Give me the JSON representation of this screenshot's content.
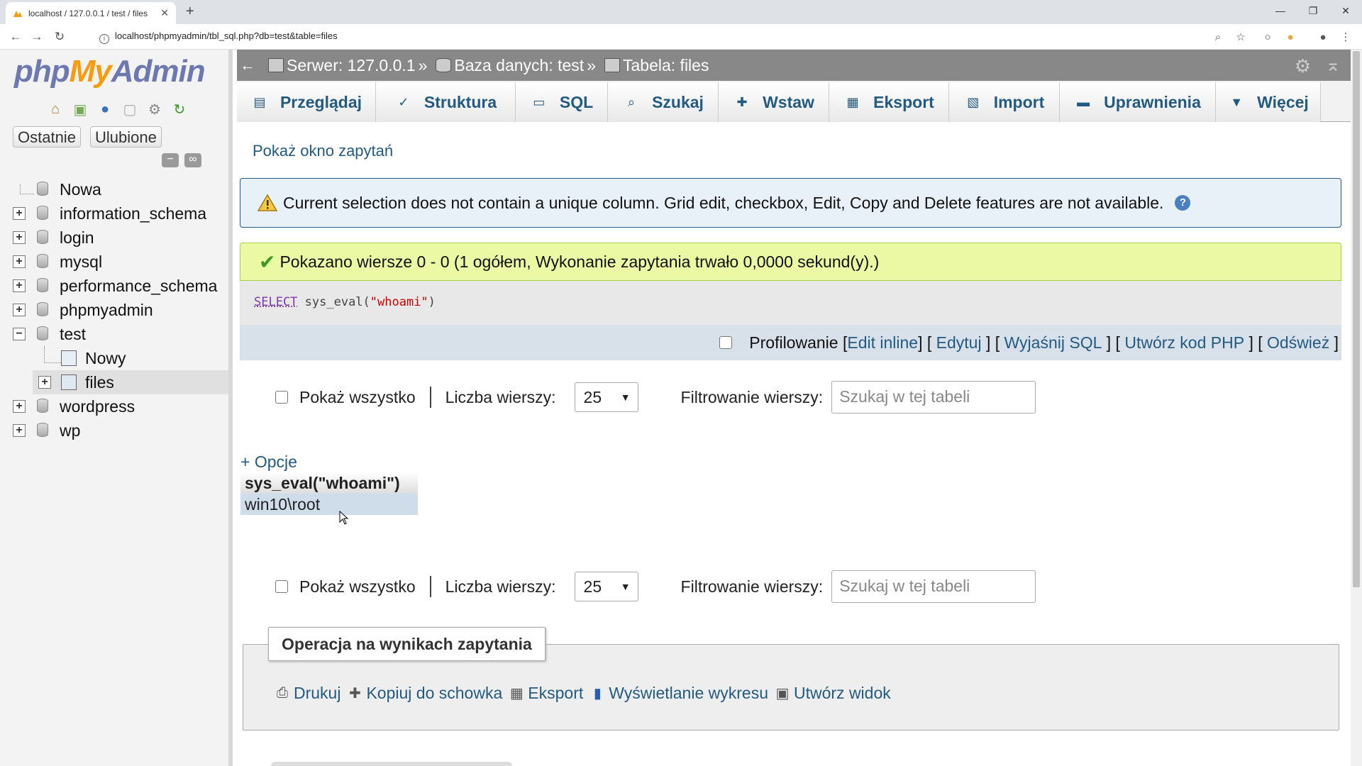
{
  "browser": {
    "tab_title": "localhost / 127.0.0.1 / test / files",
    "url": "localhost/phpmyadmin/tbl_sql.php?db=test&table=files",
    "new_tab": "+",
    "window_controls": [
      "—",
      "❐",
      "✕"
    ]
  },
  "sidebar": {
    "logo": {
      "php": "php",
      "my": "My",
      "admin": "Admin"
    },
    "quick_icons": [
      "home-icon",
      "logout-icon",
      "help-icon",
      "docs-icon",
      "settings-icon",
      "reload-icon"
    ],
    "recent_label": "Ostatnie",
    "favorites_label": "Ulubione",
    "tree": [
      {
        "label": "Nowa",
        "type": "new"
      },
      {
        "label": "information_schema",
        "type": "db"
      },
      {
        "label": "login",
        "type": "db"
      },
      {
        "label": "mysql",
        "type": "db"
      },
      {
        "label": "performance_schema",
        "type": "db"
      },
      {
        "label": "phpmyadmin",
        "type": "db"
      },
      {
        "label": "test",
        "type": "db",
        "expanded": true
      },
      {
        "label": "Nowy",
        "type": "new-table"
      },
      {
        "label": "files",
        "type": "table",
        "selected": true
      },
      {
        "label": "wordpress",
        "type": "db"
      },
      {
        "label": "wp",
        "type": "db"
      }
    ]
  },
  "breadcrumb": {
    "server": "Serwer: 127.0.0.1",
    "database": "Baza danych: test",
    "table": "Tabela: files",
    "separator": "»"
  },
  "tabs": [
    {
      "label": "Przeglądaj",
      "icon": "browse-icon"
    },
    {
      "label": "Struktura",
      "icon": "structure-icon"
    },
    {
      "label": "SQL",
      "icon": "sql-icon"
    },
    {
      "label": "Szukaj",
      "icon": "search-icon"
    },
    {
      "label": "Wstaw",
      "icon": "insert-icon"
    },
    {
      "label": "Eksport",
      "icon": "export-icon"
    },
    {
      "label": "Import",
      "icon": "import-icon"
    },
    {
      "label": "Uprawnienia",
      "icon": "privileges-icon"
    },
    {
      "label": "Więcej",
      "icon": "chevron-down-icon"
    }
  ],
  "main": {
    "show_query_window": "Pokaż okno zapytań",
    "warning": "Current selection does not contain a unique column. Grid edit, checkbox, Edit, Copy and Delete features are not available.",
    "success": "Pokazano wiersze 0 - 0 (1 ogółem, Wykonanie zapytania trwało 0,0000 sekund(y).)",
    "sql": {
      "keyword": "SELECT",
      "func": " sys_eval(",
      "arg": "\"whoami\"",
      "close": ")"
    },
    "profiling_label": "Profilowanie",
    "sql_links": {
      "edit_inline": "Edit inline",
      "edit": "Edytuj",
      "explain": "Wyjaśnij SQL",
      "php_code": "Utwórz kod PHP",
      "refresh": "Odśwież"
    },
    "show_all": "Pokaż wszystko",
    "rows_label": "Liczba wierszy:",
    "rows_value": "25",
    "filter_label": "Filtrowanie wierszy:",
    "filter_placeholder": "Szukaj w tej tabeli",
    "options": "+ Opcje",
    "result": {
      "column": "sys_eval(\"whoami\")",
      "rows": [
        "win10\\root"
      ]
    },
    "operations": {
      "legend": "Operacja na wynikach zapytania",
      "print": "Drukuj",
      "copy": "Kopiuj do schowka",
      "export": "Eksport",
      "chart": "Wyświetlanie wykresu",
      "view": "Utwórz widok"
    }
  }
}
